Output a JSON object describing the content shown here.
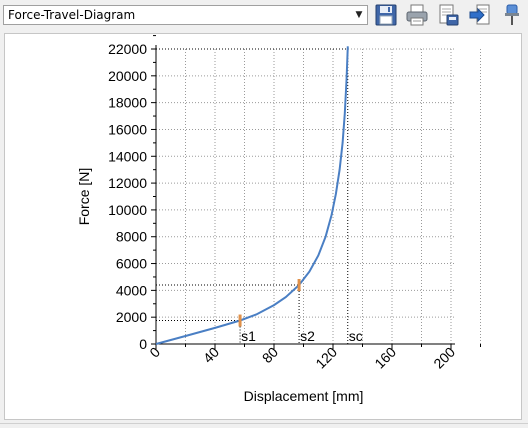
{
  "toolbar": {
    "diagram_select": "Force-Travel-Diagram",
    "dropdown_icon": "dropdown-arrow-icon",
    "buttons": [
      {
        "icon": "save-icon"
      },
      {
        "icon": "print-icon"
      },
      {
        "icon": "print-preview-icon"
      },
      {
        "icon": "export-icon"
      },
      {
        "icon": "pin-icon"
      }
    ]
  },
  "colors": {
    "curve": "#4a7fc4",
    "marker": "#e0914a",
    "axis": "#000000",
    "grid": "#9a9a9a"
  },
  "chart_data": {
    "type": "line",
    "xlabel": "Displacement [mm]",
    "ylabel": "Force [N]",
    "xlim": [
      0,
      200
    ],
    "ylim": [
      0,
      22000
    ],
    "x_ticks": [
      0,
      40,
      80,
      120,
      160,
      200
    ],
    "y_ticks": [
      0,
      2000,
      4000,
      6000,
      8000,
      10000,
      12000,
      14000,
      16000,
      18000,
      20000,
      22000
    ],
    "grid": true,
    "series": [
      {
        "x": [
          0,
          20,
          40,
          57,
          68,
          80,
          88,
          97,
          104,
          110,
          115,
          119,
          122,
          124.5,
          126.5,
          128,
          129.2,
          130
        ],
        "y": [
          0,
          600,
          1200,
          1750,
          2200,
          2900,
          3500,
          4400,
          5400,
          6600,
          8000,
          9600,
          11200,
          13000,
          15000,
          17200,
          19800,
          22200
        ]
      }
    ],
    "markers": [
      {
        "label": "s1",
        "x": 57,
        "y": 1750
      },
      {
        "label": "s2",
        "x": 97,
        "y": 4400
      },
      {
        "label": "sc",
        "x": 130,
        "y": 22200
      }
    ]
  }
}
